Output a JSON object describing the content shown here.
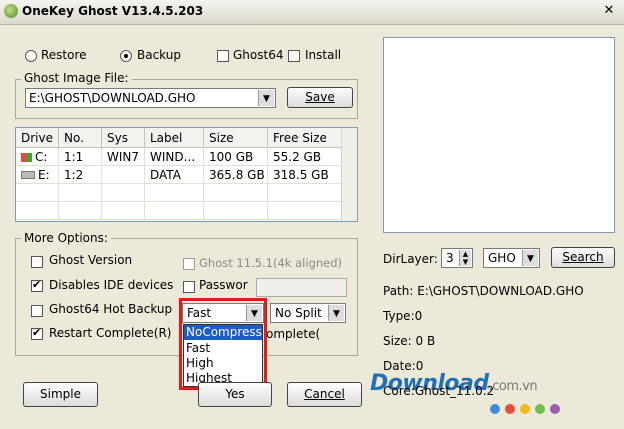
{
  "window": {
    "title": "OneKey Ghost V13.4.5.203",
    "close_glyph": "✕"
  },
  "mode": {
    "restore_label": "Restore",
    "backup_label": "Backup",
    "selected": "Backup",
    "ghost64_label": "Ghost64",
    "install_label": "Install"
  },
  "image_file": {
    "group_label": "Ghost Image File:",
    "path": "E:\\GHOST\\DOWNLOAD.GHO",
    "save_label": "Save"
  },
  "drives": {
    "columns": [
      "Drive",
      "No.",
      "Sys",
      "Label",
      "Size",
      "Free Size"
    ],
    "rows": [
      {
        "drive": "C:",
        "no": "1:1",
        "sys": "WIN7",
        "label": "WIND...",
        "size": "100 GB",
        "free": "55.2 GB",
        "icon": "windows-drive-icon"
      },
      {
        "drive": "E:",
        "no": "1:2",
        "sys": "",
        "label": "DATA",
        "size": "365.8 GB",
        "free": "318.5 GB",
        "icon": "hard-drive-icon"
      }
    ]
  },
  "options": {
    "group_label": "More Options:",
    "ghost_version": "Ghost Version",
    "disable_ide": "Disables IDE devices",
    "ghost64_hot_backup": "Ghost64 Hot Backup",
    "restart_complete": "Restart Complete(R)",
    "ghost_11": "Ghost 11.5.1(4k aligned)",
    "password": "Passwor",
    "complete_partial": "omplete(",
    "compression_value": "Fast",
    "split_value": "No Split",
    "compression_options": [
      "NoCompress",
      "Fast",
      "High",
      "Highest"
    ]
  },
  "buttons": {
    "simple": "Simple",
    "yes": "Yes",
    "cancel": "Cancel"
  },
  "right": {
    "dirlayer_label": "DirLayer:",
    "dirlayer_value": "3",
    "ext_value": "GHO",
    "search_label": "Search",
    "path": "Path: E:\\GHOST\\DOWNLOAD.GHO",
    "type": "Type:0",
    "size": "Size: 0 B",
    "date": "Date:0",
    "core": "Core:Ghost_11.0.2"
  },
  "watermark": {
    "text": "Download",
    "suffix": ".com.vn"
  },
  "colors": {
    "highlight": "#1c5cc8",
    "callout": "#e21c1c",
    "watermark": "#1f6fb9"
  }
}
